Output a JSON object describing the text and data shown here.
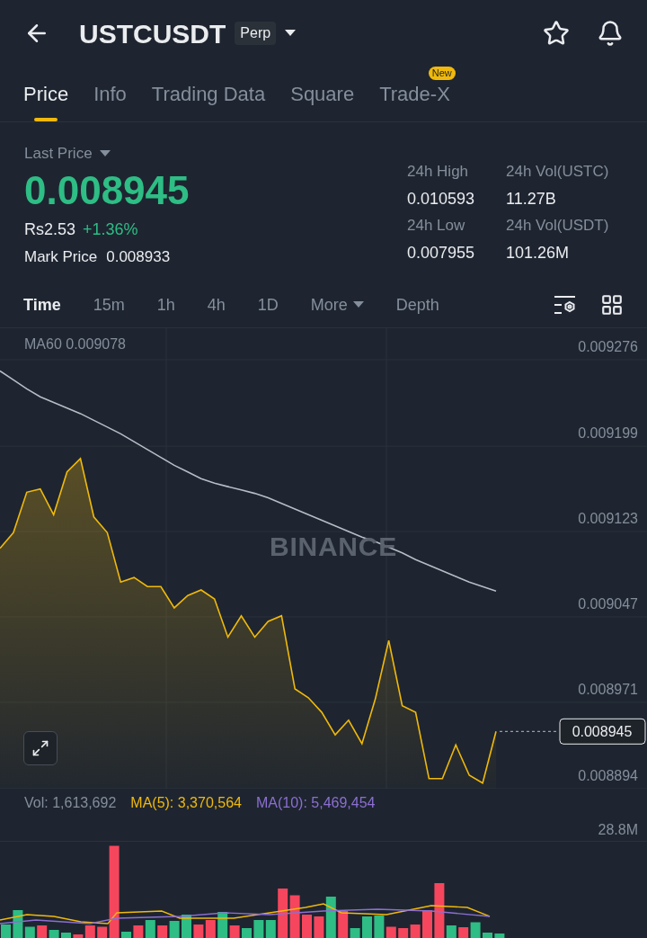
{
  "header": {
    "title": "USTCUSDT",
    "badge": "Perp"
  },
  "tabs": [
    {
      "label": "Price",
      "selected": true
    },
    {
      "label": "Info",
      "selected": false
    },
    {
      "label": "Trading Data",
      "selected": false
    },
    {
      "label": "Square",
      "selected": false
    },
    {
      "label": "Trade-X",
      "selected": false,
      "badge": "New"
    }
  ],
  "ticker": {
    "label": "Last Price",
    "price": "0.008945",
    "fiat": "Rs2.53",
    "change": "+1.36%",
    "mark_label": "Mark Price",
    "mark_value": "0.008933"
  },
  "stats": [
    {
      "label": "24h High",
      "value": "0.010593"
    },
    {
      "label": "24h Vol(USTC)",
      "value": "11.27B"
    },
    {
      "label": "24h Low",
      "value": "0.007955"
    },
    {
      "label": "24h Vol(USDT)",
      "value": "101.26M"
    }
  ],
  "intervals": [
    {
      "label": "Time",
      "kind": "interval",
      "selected": true
    },
    {
      "label": "15m",
      "kind": "interval",
      "selected": false
    },
    {
      "label": "1h",
      "kind": "interval",
      "selected": false
    },
    {
      "label": "4h",
      "kind": "interval",
      "selected": false
    },
    {
      "label": "1D",
      "kind": "interval",
      "selected": false
    },
    {
      "label": "More",
      "kind": "menu",
      "selected": false
    },
    {
      "label": "Depth",
      "kind": "interval",
      "selected": false
    }
  ],
  "chart": {
    "ma_value": "0.009078",
    "watermark": "BINANCE",
    "last_price_tag": "0.008945",
    "chart_data": {
      "type": "area",
      "grid": true,
      "ylim": [
        0.008894,
        0.009304
      ],
      "yticks": [
        0.009276,
        0.009199,
        0.009123,
        0.009047,
        0.008971,
        0.008894
      ],
      "series": [
        {
          "type": "area",
          "color": "#f0b90b",
          "values": [
            0.009108,
            0.009122,
            0.009158,
            0.009161,
            0.009138,
            0.009176,
            0.009188,
            0.009136,
            0.009122,
            0.009078,
            0.009082,
            0.009074,
            0.009074,
            0.009055,
            0.009066,
            0.009071,
            0.009063,
            0.009029,
            0.009048,
            0.009029,
            0.009043,
            0.009048,
            0.008983,
            0.008975,
            0.008962,
            0.008942,
            0.008955,
            0.008934,
            0.008974,
            0.009026,
            0.008968,
            0.008962,
            0.008903,
            0.008903,
            0.008933,
            0.008906,
            0.008899,
            0.008945
          ]
        },
        {
          "name": "MA60",
          "type": "line",
          "color": "#b7bdc6",
          "values": [
            0.009266,
            0.009258,
            0.00925,
            0.009243,
            0.009238,
            0.009233,
            0.009228,
            0.009222,
            0.009216,
            0.00921,
            0.009203,
            0.009196,
            0.009189,
            0.009182,
            0.009176,
            0.00917,
            0.009166,
            0.009163,
            0.00916,
            0.009157,
            0.009153,
            0.009148,
            0.009143,
            0.009138,
            0.009133,
            0.009128,
            0.009123,
            0.009118,
            0.009114,
            0.009109,
            0.009104,
            0.009098,
            0.009093,
            0.009088,
            0.009083,
            0.009078,
            0.009074,
            0.00907
          ]
        }
      ]
    }
  },
  "volume": {
    "legend": [
      {
        "text": "Vol: 1,613,692",
        "color": "#848e9c"
      },
      {
        "text": "MA(5): 3,370,564",
        "color": "#f0b90b"
      },
      {
        "text": "MA(10): 5,469,454",
        "color": "#8c6fd1"
      }
    ],
    "axis_label": "28.8M"
  }
}
